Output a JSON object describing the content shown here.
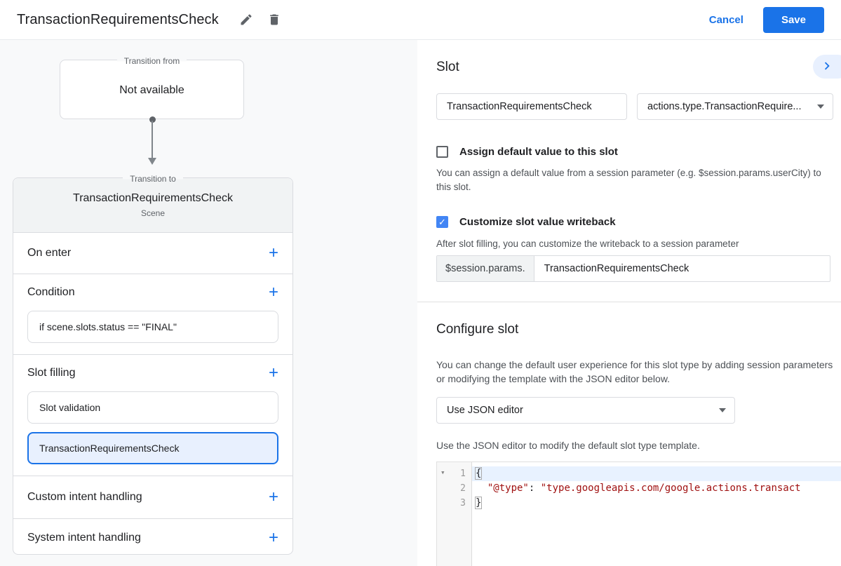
{
  "colors": {
    "accent": "#1a73e8",
    "checkbox_checked": "#4285f4",
    "selected_item_bg": "#e8f0fe",
    "code_string": "#a01111",
    "active_line_bg": "#e8f2ff"
  },
  "header": {
    "title": "TransactionRequirementsCheck",
    "cancel_label": "Cancel",
    "save_label": "Save"
  },
  "icons": {
    "edit": "pencil",
    "delete": "trash",
    "collapse": "chevron-right",
    "dropdown": "caret-down",
    "add": "+",
    "check": "✓",
    "fold": "▾"
  },
  "diagram": {
    "transition_from_label": "Transition from",
    "transition_from_value": "Not available",
    "transition_to_label": "Transition to",
    "scene": {
      "title": "TransactionRequirementsCheck",
      "subtitle": "Scene"
    },
    "sections": [
      {
        "label": "On enter"
      },
      {
        "label": "Condition",
        "items": [
          "if scene.slots.status == \"FINAL\""
        ]
      },
      {
        "label": "Slot filling",
        "items": [
          "Slot validation",
          "TransactionRequirementsCheck"
        ]
      },
      {
        "label": "Custom intent handling"
      },
      {
        "label": "System intent handling"
      }
    ]
  },
  "slot_panel": {
    "heading": "Slot",
    "name_value": "TransactionRequirementsCheck",
    "type_value": "actions.type.TransactionRequire...",
    "assign_default": {
      "label": "Assign default value to this slot",
      "checked": false,
      "description": "You can assign a default value from a session parameter (e.g. $session.params.userCity) to this slot."
    },
    "writeback": {
      "label": "Customize slot value writeback",
      "checked": true,
      "description": "After slot filling, you can customize the writeback to a session parameter",
      "prefix": "$session.params.",
      "value": "TransactionRequirementsCheck"
    }
  },
  "configure_panel": {
    "heading": "Configure slot",
    "description": "You can change the default user experience for this slot type by adding session parameters or modifying the template with the JSON editor below.",
    "mode_value": "Use JSON editor",
    "hint": "Use the JSON editor to modify the default slot type template.",
    "editor": {
      "line_numbers": [
        "1",
        "2",
        "3"
      ],
      "line1": "{",
      "line2": {
        "indent": "  ",
        "key": "\"@type\"",
        "sep": ": ",
        "value": "\"type.googleapis.com/google.actions.transact"
      },
      "line3": "}"
    }
  }
}
